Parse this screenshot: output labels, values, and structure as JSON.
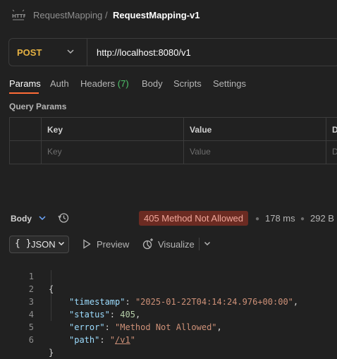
{
  "breadcrumb": {
    "parent": "RequestMapping",
    "separator": "/",
    "current": "RequestMapping-v1"
  },
  "request": {
    "method": "POST",
    "url": "http://localhost:8080/v1",
    "method_color": "#e6b243"
  },
  "tabs": [
    {
      "label": "Params",
      "active": true
    },
    {
      "label": "Auth"
    },
    {
      "label": "Headers",
      "count": "(7)"
    },
    {
      "label": "Body"
    },
    {
      "label": "Scripts"
    },
    {
      "label": "Settings"
    }
  ],
  "query_params": {
    "title": "Query Params",
    "columns": [
      "Key",
      "Value",
      "D"
    ],
    "placeholders": [
      "Key",
      "Value",
      "D"
    ]
  },
  "response": {
    "label": "Body",
    "status": "405 Method Not Allowed",
    "time": "178 ms",
    "size": "292 B"
  },
  "format": {
    "label": "JSON",
    "braces": "{ }",
    "preview": "Preview",
    "visualize": "Visualize"
  },
  "code_lines": [
    {
      "n": "1",
      "open": "{"
    },
    {
      "n": "2",
      "key": "\"timestamp\"",
      "sep": ": ",
      "value": "\"2025-01-22T04:14:24.976+00:00\"",
      "vtype": "s",
      "tail": ","
    },
    {
      "n": "3",
      "key": "\"status\"",
      "sep": ": ",
      "value": "405",
      "vtype": "n",
      "tail": ","
    },
    {
      "n": "4",
      "key": "\"error\"",
      "sep": ": ",
      "value": "\"Method Not Allowed\"",
      "vtype": "s",
      "tail": ","
    },
    {
      "n": "5",
      "key": "\"path\"",
      "sep": ": ",
      "value_pre": "\"",
      "value_link": "/v1",
      "value_post": "\"",
      "vtype": "u"
    },
    {
      "n": "6",
      "open": "}"
    }
  ]
}
